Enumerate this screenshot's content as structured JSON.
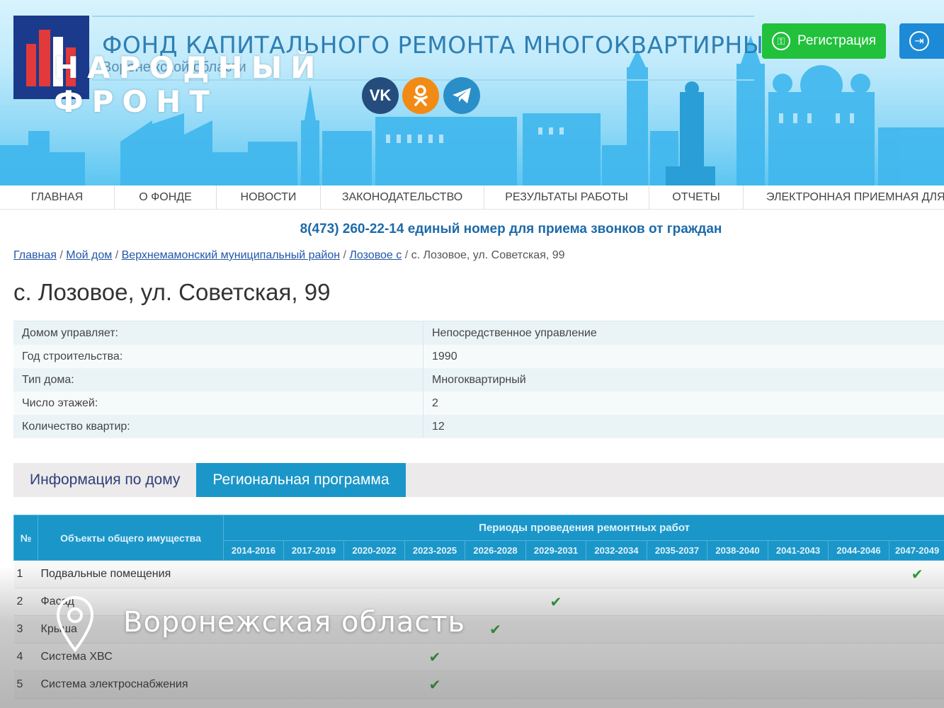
{
  "header": {
    "site_title": "ФОНД КАПИТАЛЬНОГО РЕМОНТА МНОГОКВАРТИРНЫХ ДОМОВ",
    "site_subtitle": "Воронежской области",
    "watermark_line1": "НАРОДНЫЙ",
    "watermark_line2": "ФРОНТ",
    "social": [
      {
        "label": "VK",
        "icon": "vk-icon"
      },
      {
        "label": "OK",
        "icon": "odnoklassniki-icon"
      },
      {
        "label": "TG",
        "icon": "telegram-icon"
      }
    ],
    "register_label": "Регистрация",
    "register_color": "#21c13c",
    "login_color": "#1c8ad6"
  },
  "nav": {
    "items": [
      "ГЛАВНАЯ",
      "О ФОНДЕ",
      "НОВОСТИ",
      "ЗАКОНОДАТЕЛЬСТВО",
      "РЕЗУЛЬТАТЫ РАБОТЫ",
      "ОТЧЕТЫ",
      "ЭЛЕКТРОННАЯ ПРИЕМНАЯ ДЛЯ ГРАЖДАН"
    ]
  },
  "phone_line": "8(473) 260-22-14 единый номер для приема звонков от граждан",
  "breadcrumb": {
    "links": [
      "Главная",
      "Мой дом",
      "Верхнемамонский муниципальный район",
      "Лозовое с"
    ],
    "current": "с. Лозовое, ул. Советская, 99"
  },
  "page_title": "с. Лозовое, ул. Советская, 99",
  "house_info": [
    {
      "key": "Домом управляет:",
      "value": "Непосредственное управление"
    },
    {
      "key": "Год строительства:",
      "value": "1990"
    },
    {
      "key": "Тип дома:",
      "value": "Многоквартирный"
    },
    {
      "key": "Число этажей:",
      "value": "2"
    },
    {
      "key": "Количество квартир:",
      "value": "12"
    }
  ],
  "tabs": [
    {
      "label": "Информация по дому",
      "active": false
    },
    {
      "label": "Региональная программа",
      "active": true
    }
  ],
  "program": {
    "col_num": "№",
    "col_object": "Объекты общего имущества",
    "col_periods": "Периоды проведения ремонтных работ",
    "periods": [
      "2014-2016",
      "2017-2019",
      "2020-2022",
      "2023-2025",
      "2026-2028",
      "2029-2031",
      "2032-2034",
      "2035-2037",
      "2038-2040",
      "2041-2043",
      "2044-2046",
      "2047-2049"
    ],
    "rows": [
      {
        "num": "1",
        "object": "Подвальные помещения",
        "period": "2047-2049"
      },
      {
        "num": "2",
        "object": "Фасад",
        "period": "2029-2031"
      },
      {
        "num": "3",
        "object": "Крыша",
        "period": "2026-2028"
      },
      {
        "num": "4",
        "object": "Система ХВС",
        "period": "2023-2025"
      },
      {
        "num": "5",
        "object": "Система электроснабжения",
        "period": "2023-2025"
      }
    ],
    "check_color": "#2e9b3a",
    "header_color": "#1b96c8"
  },
  "location": {
    "icon": "map-pin-icon",
    "label": "Воронежская область"
  }
}
